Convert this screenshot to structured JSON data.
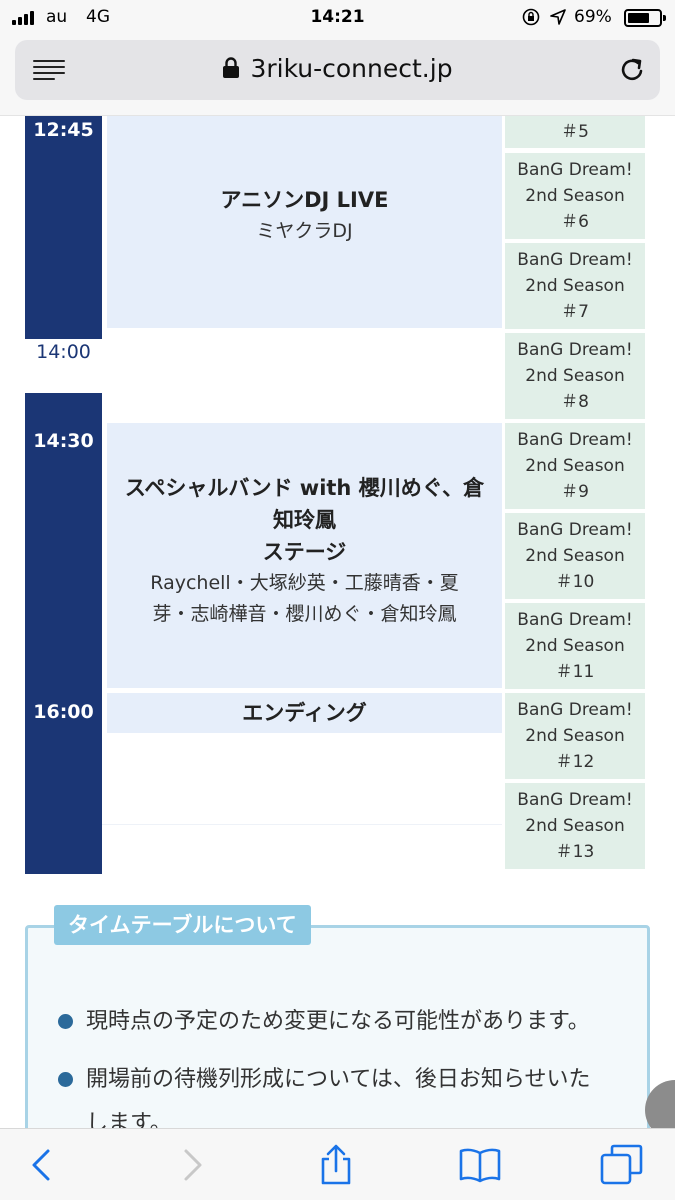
{
  "status_bar": {
    "carrier": "au",
    "network": "4G",
    "time": "14:21",
    "battery_percent": "69%",
    "battery_level": 0.69
  },
  "address_bar": {
    "url": "3riku-connect.jp"
  },
  "timetable": {
    "times": [
      "12:45",
      "14:00",
      "14:30",
      "16:00"
    ],
    "stages": [
      {
        "title": "アニソンDJ LIVE",
        "subtitle": "ミヤクラDJ"
      },
      {
        "title_line1": "スペシャルバンド with 櫻川めぐ、倉",
        "title_line2": "知玲鳳",
        "title_line3": "ステージ",
        "performers_line1": "Raychell・大塚紗英・工藤晴香・夏",
        "performers_line2": "芽・志崎樺音・櫻川めぐ・倉知玲鳳"
      },
      {
        "title": "エンディング"
      }
    ],
    "episodes": [
      {
        "line3": "＃5"
      },
      {
        "line1": "BanG Dream!",
        "line2": "2nd Season",
        "line3": "＃6"
      },
      {
        "line1": "BanG Dream!",
        "line2": "2nd Season",
        "line3": "＃7"
      },
      {
        "line1": "BanG Dream!",
        "line2": "2nd Season",
        "line3": "＃8"
      },
      {
        "line1": "BanG Dream!",
        "line2": "2nd Season",
        "line3": "＃9"
      },
      {
        "line1": "BanG Dream!",
        "line2": "2nd Season",
        "line3": "＃10"
      },
      {
        "line1": "BanG Dream!",
        "line2": "2nd Season",
        "line3": "＃11"
      },
      {
        "line1": "BanG Dream!",
        "line2": "2nd Season",
        "line3": "＃12"
      },
      {
        "line1": "BanG Dream!",
        "line2": "2nd Season",
        "line3": "＃13"
      }
    ]
  },
  "notes": {
    "heading": "タイムテーブルについて",
    "items": [
      "現時点の予定のため変更になる可能性があります。",
      "開場前の待機列形成については、後日お知らせいた",
      "します。"
    ]
  },
  "colors": {
    "time_column": "#1b3675",
    "stage_block": "#e6eefa",
    "episode_block": "#e1efe8",
    "notes_border": "#a8d3e6",
    "notes_tag": "#8dc9e3",
    "bullet": "#2b6a9a"
  },
  "toolbar_icons": [
    "back-icon",
    "forward-icon",
    "share-icon",
    "bookmarks-icon",
    "tabs-icon"
  ]
}
